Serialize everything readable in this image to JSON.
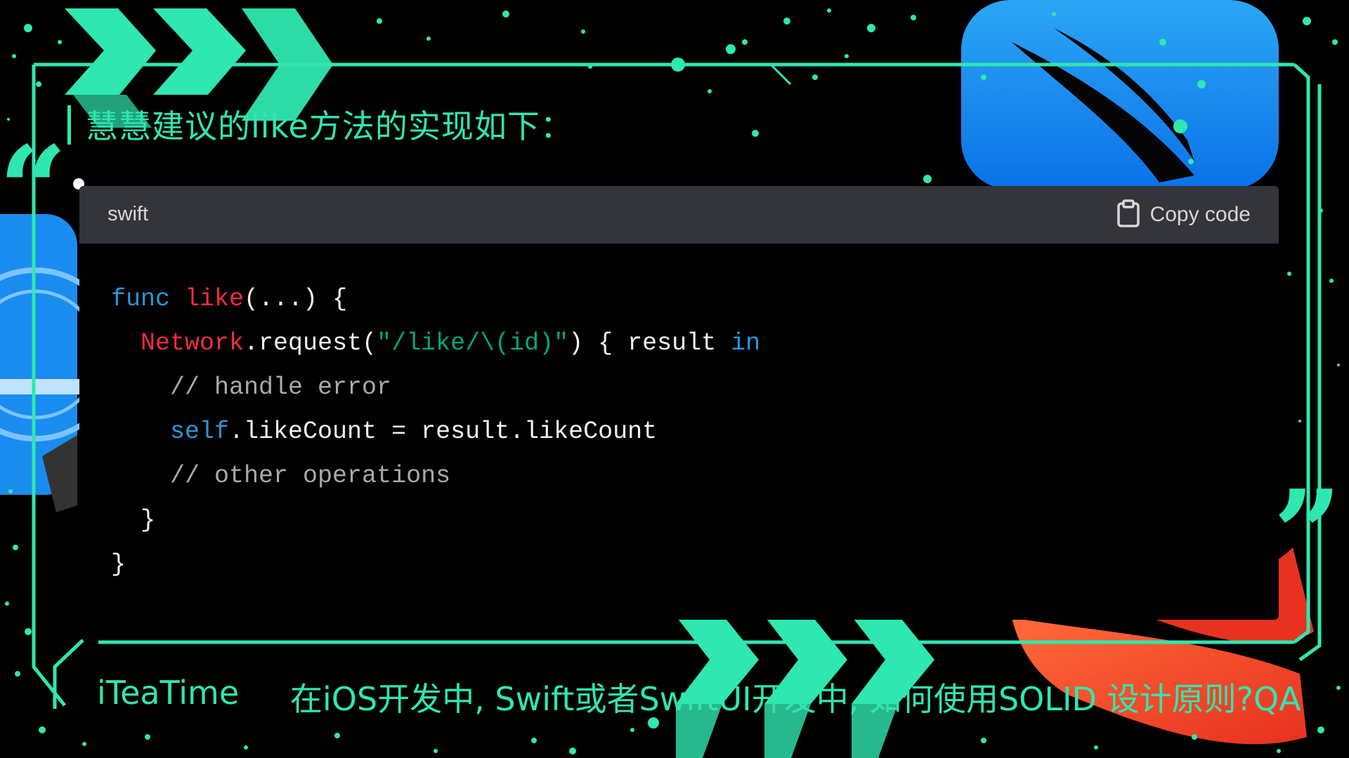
{
  "heading": "慧慧建议的like方法的实现如下：",
  "code_block": {
    "language": "swift",
    "copy_label": "Copy code",
    "lines": [
      [
        {
          "t": "func ",
          "c": "kw"
        },
        {
          "t": "like",
          "c": "fn"
        },
        {
          "t": "(...) {",
          "c": ""
        }
      ],
      [
        {
          "t": "  ",
          "c": ""
        },
        {
          "t": "Network",
          "c": "ty"
        },
        {
          "t": ".request(",
          "c": ""
        },
        {
          "t": "\"/like/\\(id)\"",
          "c": "str"
        },
        {
          "t": ") { result ",
          "c": ""
        },
        {
          "t": "in",
          "c": "kw"
        }
      ],
      [
        {
          "t": "    // handle error",
          "c": "cm"
        }
      ],
      [
        {
          "t": "    ",
          "c": ""
        },
        {
          "t": "self",
          "c": "kw"
        },
        {
          "t": ".likeCount = result.likeCount",
          "c": ""
        }
      ],
      [
        {
          "t": "    // other operations",
          "c": "cm"
        }
      ],
      [
        {
          "t": "  }",
          "c": ""
        }
      ],
      [
        {
          "t": "}",
          "c": ""
        }
      ]
    ]
  },
  "footer": {
    "brand": "iTeaTime",
    "title": "在iOS开发中, Swift或者SwiftUI开发中, 如何使用SOLID 设计原则?QA"
  },
  "colors": {
    "accent": "#2fe7b0",
    "keyword": "#2e95d3",
    "function": "#f22c3d",
    "string": "#00a67d",
    "comment": "#a9a9a9",
    "header_bg": "#34343b"
  },
  "icons": [
    "clipboard-icon",
    "chevron-arrows-icon",
    "quote-open-icon",
    "quote-close-icon",
    "swift-logo-icon",
    "xcode-logo-icon"
  ]
}
